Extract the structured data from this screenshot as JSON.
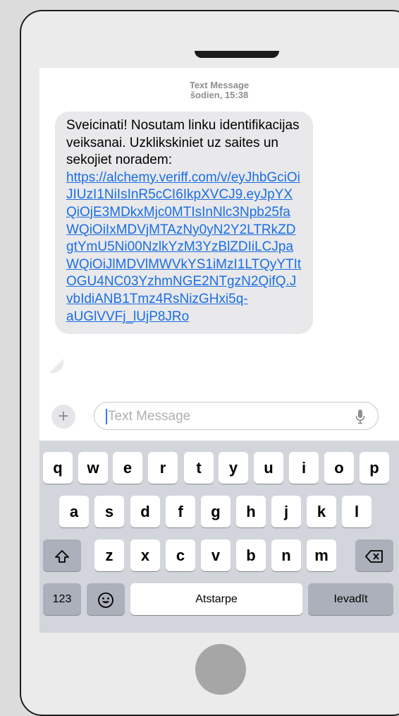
{
  "conversation": {
    "type_label": "Text Message",
    "timestamp": "šodien, 15:38"
  },
  "message": {
    "text": "Sveicinati! Nosutam linku identifikacijas veiksanai. Uzklikskiniet uz saites un sekojiet noradem: ",
    "link": "https://alchemy.veriff.com/v/eyJhbGciOiJIUzI1NiIsInR5cCI6IkpXVCJ9.eyJpYXQiOjE3MDkxMjc0MTIsInNlc3Npb25faWQiOiIxMDVjMTAzNy0yN2Y2LTRkZDgtYmU5Ni00NzlkYzM3YzBlZDIiLCJpaWQiOiJlMDVlMWVkYS1iMzI1LTQyYTItOGU4NC03YzhmNGE2NTgzN2QifQ.JvbIdiANB1Tmz4RsNizGHxi5q-aUGlVVFj_lUjP8JRo"
  },
  "compose": {
    "placeholder": "Text Message",
    "add_icon": "plus-icon",
    "mic_icon": "microphone-icon"
  },
  "keyboard": {
    "row1": [
      "q",
      "w",
      "e",
      "r",
      "t",
      "y",
      "u",
      "i",
      "o",
      "p"
    ],
    "row2": [
      "a",
      "s",
      "d",
      "f",
      "g",
      "h",
      "j",
      "k",
      "l"
    ],
    "row3": [
      "z",
      "x",
      "c",
      "v",
      "b",
      "n",
      "m"
    ],
    "shift_icon": "shift-icon",
    "delete_icon": "backspace-icon",
    "numbers_label": "123",
    "emoji_icon": "emoji-icon",
    "space_label": "Atstarpe",
    "return_label": "Ievadīt"
  },
  "colors": {
    "link": "#1b6ee4",
    "bubble": "#e9e9eb",
    "keyboard_bg": "#d2d5db"
  }
}
